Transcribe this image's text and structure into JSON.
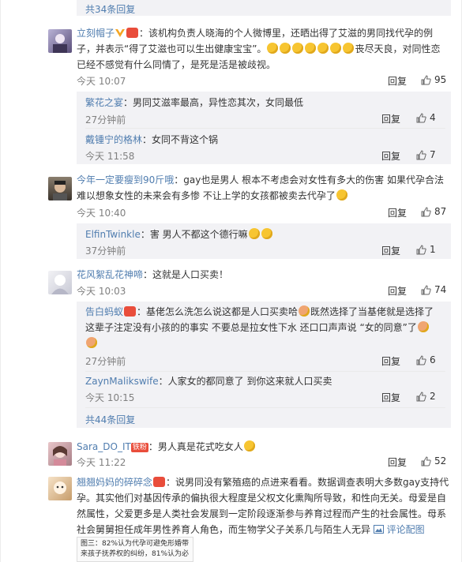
{
  "top_more": "共34条回复",
  "comments": [
    {
      "user": "立刻帽子",
      "text_a": "：该机构负责人晓海的个人微博里，还晒出得了艾滋的男同找代孕的例子，并表示“得了艾滋也可以生出健康宝宝”。",
      "text_b": "丧尽天良，对同性恋已经不感觉有什么同情了，是死是活是被歧视。",
      "time": "今天 10:07",
      "reply": "回复",
      "likes": "95"
    },
    {
      "user": "今年一定要瘦到90斤哦",
      "text_a": "：gay也是男人 根本不考虑会对女性有多大的伤害 如果代孕合法 难以想象女性的未来会有多惨 不让上学的女孩都被卖去代孕了",
      "time": "今天 10:40",
      "reply": "回复",
      "likes": "87"
    },
    {
      "user": "花风絮乱花神啼",
      "text_a": "：这就是人口买卖！",
      "time": "今天 10:03",
      "reply": "回复",
      "likes": "74"
    },
    {
      "user": "Sara_DO_IT",
      "text_a": "：男人真是花式吃女人",
      "time": "今天 11:22",
      "reply": "回复",
      "likes": "52"
    },
    {
      "user": "翘翘妈妈的碎碎念",
      "text_a": "：说男同没有繁殖癌的点进来看看。数据调查表明大多数gay支持代孕。其实他们对基因传承的偏执很大程度是父权文化熏陶所导致，和性向无关。母爱是自然属性，父爱更多是人类社会发展到一定阶段逐渐参与养育过程而产生的社会属性。母系社会舅舅担任成年男性养育人角色，而生物学父子关系几与陌生人无异",
      "review_pic": "评论配图"
    }
  ],
  "replies1": [
    {
      "user": "繁花之宴",
      "text": "：男同艾滋率最高，异性恋其次，女同最低",
      "time": "27分钟前",
      "reply": "回复",
      "likes": "4"
    },
    {
      "user": "戴锺宁的格林",
      "text": "：女同不背这个锅",
      "time": "今天 11:58",
      "reply": "回复",
      "likes": "7"
    }
  ],
  "replies2": [
    {
      "user": "ElfinTwinkle",
      "text": "：害 男人不都这个德行嘛",
      "time": "37分钟前",
      "reply": "回复",
      "likes": "1"
    }
  ],
  "replies3": [
    {
      "user": "告白蚂蚁",
      "text": "：基佬怎么洗怎么说这都是人口买卖哈",
      "text_b": "既然选择了当基佬就是选择了这辈子注定没有小孩的的事实 不要总是拉女性下水 还口口声声说 “女的同意”了",
      "time": "27分钟前",
      "reply": "回复",
      "likes": "6"
    },
    {
      "user": "ZaynMalikswife",
      "text": "：人家女的都同意了 到你这来就人口买卖",
      "time": "今天 10:15",
      "reply": "回复",
      "likes": "2"
    }
  ],
  "more2": "共44条回复",
  "badge_label": "铁粉",
  "pic_caption": "图三：82%认为代孕可避免形婚带来孩子抚养权的纠纷，81%认为必"
}
